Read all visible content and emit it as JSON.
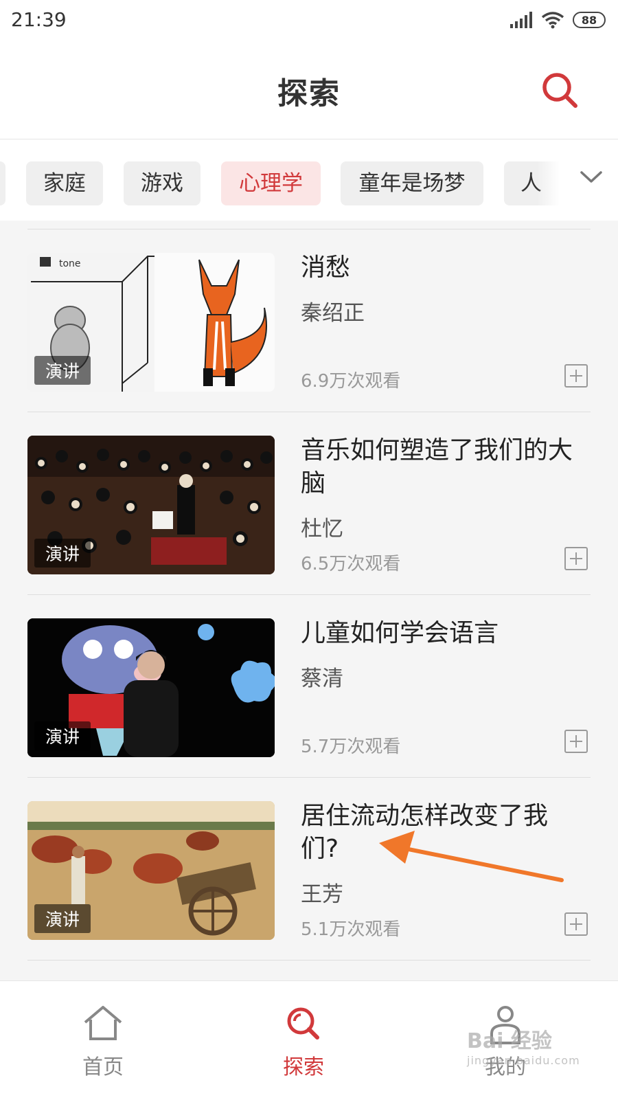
{
  "status_bar": {
    "time": "21:39",
    "battery": "88"
  },
  "header": {
    "title": "探索"
  },
  "tabs": {
    "items": [
      {
        "label": "家庭",
        "active": false
      },
      {
        "label": "游戏",
        "active": false
      },
      {
        "label": "心理学",
        "active": true
      },
      {
        "label": "童年是场梦",
        "active": false
      },
      {
        "label": "人",
        "active": false
      }
    ]
  },
  "videos": [
    {
      "title": "消愁",
      "author": "秦绍正",
      "views": "6.9万次观看",
      "tag": "演讲",
      "thumb_text": "tone"
    },
    {
      "title": "音乐如何塑造了我们的大脑",
      "author": "杜忆",
      "views": "6.5万次观看",
      "tag": "演讲"
    },
    {
      "title": "儿童如何学会语言",
      "author": "蔡清",
      "views": "5.7万次观看",
      "tag": "演讲"
    },
    {
      "title": "居住流动怎样改变了我们?",
      "author": "王芳",
      "views": "5.1万次观看",
      "tag": "演讲"
    }
  ],
  "bottom_nav": {
    "items": [
      {
        "label": "首页",
        "icon": "home-icon",
        "active": false
      },
      {
        "label": "探索",
        "icon": "search-icon",
        "active": true
      },
      {
        "label": "我的",
        "icon": "user-icon",
        "active": false
      }
    ]
  },
  "watermark": {
    "brand": "Bai 经验",
    "url": "jingyan.baidu.com"
  },
  "colors": {
    "accent": "#d1393b",
    "annotation_arrow": "#f0772a"
  }
}
